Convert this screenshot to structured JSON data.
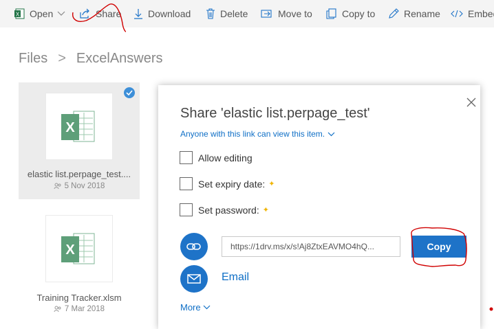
{
  "toolbar": {
    "open": "Open",
    "share": "Share",
    "download": "Download",
    "delete": "Delete",
    "move_to": "Move to",
    "copy_to": "Copy to",
    "rename": "Rename",
    "embed": "Embed"
  },
  "breadcrumb": {
    "root": "Files",
    "separator": ">",
    "current": "ExcelAnswers"
  },
  "files": [
    {
      "name": "elastic list.perpage_test....",
      "date": "5 Nov 2018",
      "selected": true
    },
    {
      "name": "Training Tracker.xlsm",
      "date": "7 Mar 2018",
      "selected": false
    }
  ],
  "dialog": {
    "title": "Share 'elastic list.perpage_test'",
    "link_permission": "Anyone with this link can view this item.",
    "options": [
      {
        "label": "Allow editing",
        "premium": false
      },
      {
        "label": "Set expiry date:",
        "premium": true
      },
      {
        "label": "Set password:",
        "premium": true
      }
    ],
    "url": "https://1drv.ms/x/s!Aj8ZtxEAVMO4hQ...",
    "copy_label": "Copy",
    "email_label": "Email",
    "more_label": "More"
  },
  "colors": {
    "accent": "#1e73c8",
    "link": "#0f6fc6",
    "excel_green": "#217346",
    "premium_star": "#f0b400",
    "annotation_red": "#d00000"
  },
  "icons": [
    "excel-icon",
    "share-icon",
    "download-icon",
    "delete-icon",
    "move-icon",
    "copy-icon",
    "rename-icon",
    "embed-icon",
    "close-icon",
    "link-icon",
    "mail-icon",
    "chevron-down-icon",
    "sharing-icon",
    "check-icon"
  ]
}
